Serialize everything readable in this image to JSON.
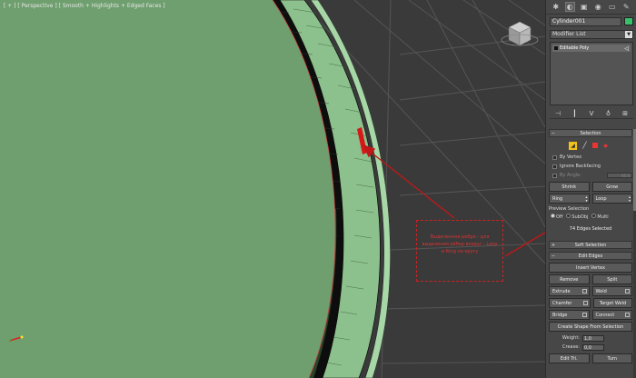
{
  "viewport": {
    "label": "[ + ] [ Perspective ] [ Smooth + Highlights + Edged Faces ]",
    "annotation_text": "Выделенное ребро - для выделения рёбер вокруг - Loop и Ring по кругу",
    "colors": {
      "object": "#6f9f6f",
      "background": "#3a3a3a",
      "arrow": "#c01818"
    }
  },
  "panel": {
    "tabs": [
      {
        "name": "create-tab",
        "icon": "✱"
      },
      {
        "name": "modify-tab",
        "icon": "◐"
      },
      {
        "name": "hierarchy-tab",
        "icon": "▣"
      },
      {
        "name": "motion-tab",
        "icon": "◉"
      },
      {
        "name": "display-tab",
        "icon": "▭"
      },
      {
        "name": "utilities-tab",
        "icon": "✎"
      }
    ],
    "object_name": "Cylinder001",
    "object_color": "#37c06a",
    "modifier_list": "Modifier List",
    "stack_item": "Editable Poly",
    "stack_tools": [
      "⊣",
      "┃",
      "Ⅴ",
      "♁",
      "⊞"
    ],
    "selection": {
      "header": "Selection",
      "by_vertex": "By Vertex",
      "ignore_backfacing": "Ignore Backfacing",
      "by_angle": "By Angle:",
      "by_angle_value": "45.0",
      "shrink": "Shrink",
      "grow": "Grow",
      "ring": "Ring",
      "loop": "Loop",
      "preview_label": "Preview Selection",
      "preview_off": "Off",
      "preview_subobj": "SubObj",
      "preview_multi": "Multi",
      "count": "74 Edges Selected"
    },
    "soft_selection": {
      "header": "Soft Selection"
    },
    "edit_edges": {
      "header": "Edit Edges",
      "insert_vertex": "Insert Vertex",
      "remove": "Remove",
      "split": "Split",
      "extrude": "Extrude",
      "weld": "Weld",
      "chamfer": "Chamfer",
      "target_weld": "Target Weld",
      "bridge": "Bridge",
      "connect": "Connect",
      "create_shape": "Create Shape From Selection",
      "weight_label": "Weight:",
      "weight_value": "1,0",
      "crease_label": "Crease:",
      "crease_value": "0,0",
      "edit_tri": "Edit Tri.",
      "turn": "Turn"
    }
  }
}
